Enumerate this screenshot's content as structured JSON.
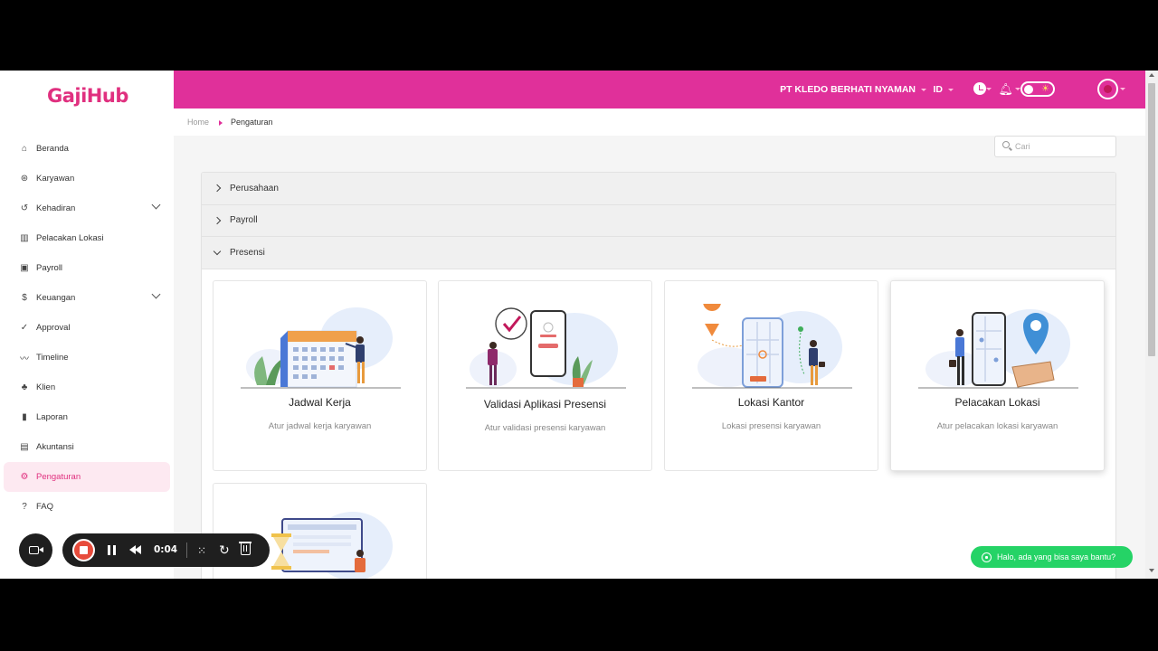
{
  "brand": {
    "logo_text": "GajiHub",
    "accent": "#e0309a",
    "active_bg": "#fde9f1"
  },
  "sidebar": {
    "items": [
      {
        "label": "Beranda",
        "icon": "home-icon",
        "glyph": "⌂",
        "has_children": false,
        "active": false
      },
      {
        "label": "Karyawan",
        "icon": "employee-icon",
        "glyph": "⊛",
        "has_children": false,
        "active": false
      },
      {
        "label": "Kehadiran",
        "icon": "attendance-icon",
        "glyph": "↺",
        "has_children": true,
        "active": false
      },
      {
        "label": "Pelacakan Lokasi",
        "icon": "map-icon",
        "glyph": "▥",
        "has_children": false,
        "active": false
      },
      {
        "label": "Payroll",
        "icon": "payroll-icon",
        "glyph": "▣",
        "has_children": false,
        "active": false
      },
      {
        "label": "Keuangan",
        "icon": "finance-icon",
        "glyph": "$",
        "has_children": true,
        "active": false
      },
      {
        "label": "Approval",
        "icon": "approval-icon",
        "glyph": "✓",
        "has_children": false,
        "active": false
      },
      {
        "label": "Timeline",
        "icon": "timeline-icon",
        "glyph": "〰",
        "has_children": false,
        "active": false
      },
      {
        "label": "Klien",
        "icon": "client-icon",
        "glyph": "♣",
        "has_children": false,
        "active": false
      },
      {
        "label": "Laporan",
        "icon": "report-icon",
        "glyph": "▮",
        "has_children": false,
        "active": false
      },
      {
        "label": "Akuntansi",
        "icon": "accounting-icon",
        "glyph": "▤",
        "has_children": false,
        "active": false
      },
      {
        "label": "Pengaturan",
        "icon": "gear-icon",
        "glyph": "⚙",
        "has_children": false,
        "active": true
      },
      {
        "label": "FAQ",
        "icon": "question-icon",
        "glyph": "?",
        "has_children": false,
        "active": false
      }
    ]
  },
  "header": {
    "company": "PT KLEDO BERHATI NYAMAN",
    "language": "ID",
    "theme_toggle": "light"
  },
  "breadcrumb": {
    "home": "Home",
    "current": "Pengaturan"
  },
  "search": {
    "placeholder": "Cari",
    "value": ""
  },
  "accordion": {
    "sections": [
      {
        "label": "Perusahaan",
        "open": false
      },
      {
        "label": "Payroll",
        "open": false
      },
      {
        "label": "Presensi",
        "open": true
      }
    ]
  },
  "cards": [
    {
      "title": "Jadwal Kerja",
      "desc": "Atur jadwal kerja karyawan",
      "illustration": "calendar-illustration"
    },
    {
      "title": "Validasi Aplikasi Presensi",
      "desc": "Atur validasi presensi karyawan",
      "illustration": "phone-check-illustration"
    },
    {
      "title": "Lokasi Kantor",
      "desc": "Lokasi presensi karyawan",
      "illustration": "map-phone-illustration"
    },
    {
      "title": "Pelacakan Lokasi",
      "desc": "Atur pelacakan lokasi karyawan",
      "illustration": "location-pin-illustration"
    },
    {
      "title": "",
      "desc": "",
      "illustration": "monitor-hourglass-illustration"
    }
  ],
  "chat_widget": {
    "label": "Halo, ada yang bisa saya bantu?",
    "color": "#25d366"
  },
  "recorder": {
    "elapsed": "0:04"
  }
}
